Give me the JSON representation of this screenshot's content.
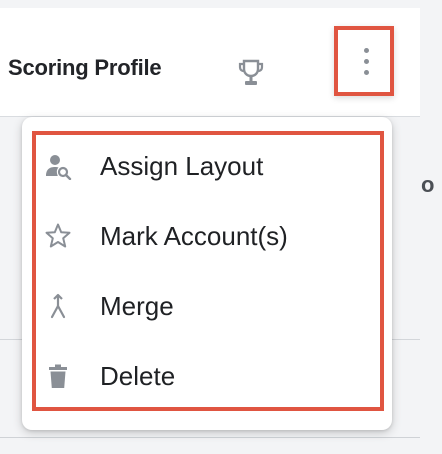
{
  "header": {
    "title": "Scoring Profile",
    "trophy_icon": "trophy-icon",
    "more_icon": "kebab-vertical-icon"
  },
  "background": {
    "peek_letter": "o"
  },
  "menu": {
    "items": [
      {
        "label": "Assign Layout",
        "icon": "user-search-icon"
      },
      {
        "label": "Mark Account(s)",
        "icon": "star-outline-icon"
      },
      {
        "label": "Merge",
        "icon": "merge-icon"
      },
      {
        "label": "Delete",
        "icon": "trash-icon"
      }
    ]
  },
  "colors": {
    "highlight": "#e05541",
    "icon_gray": "#8a8f96",
    "text": "#1f2124"
  }
}
